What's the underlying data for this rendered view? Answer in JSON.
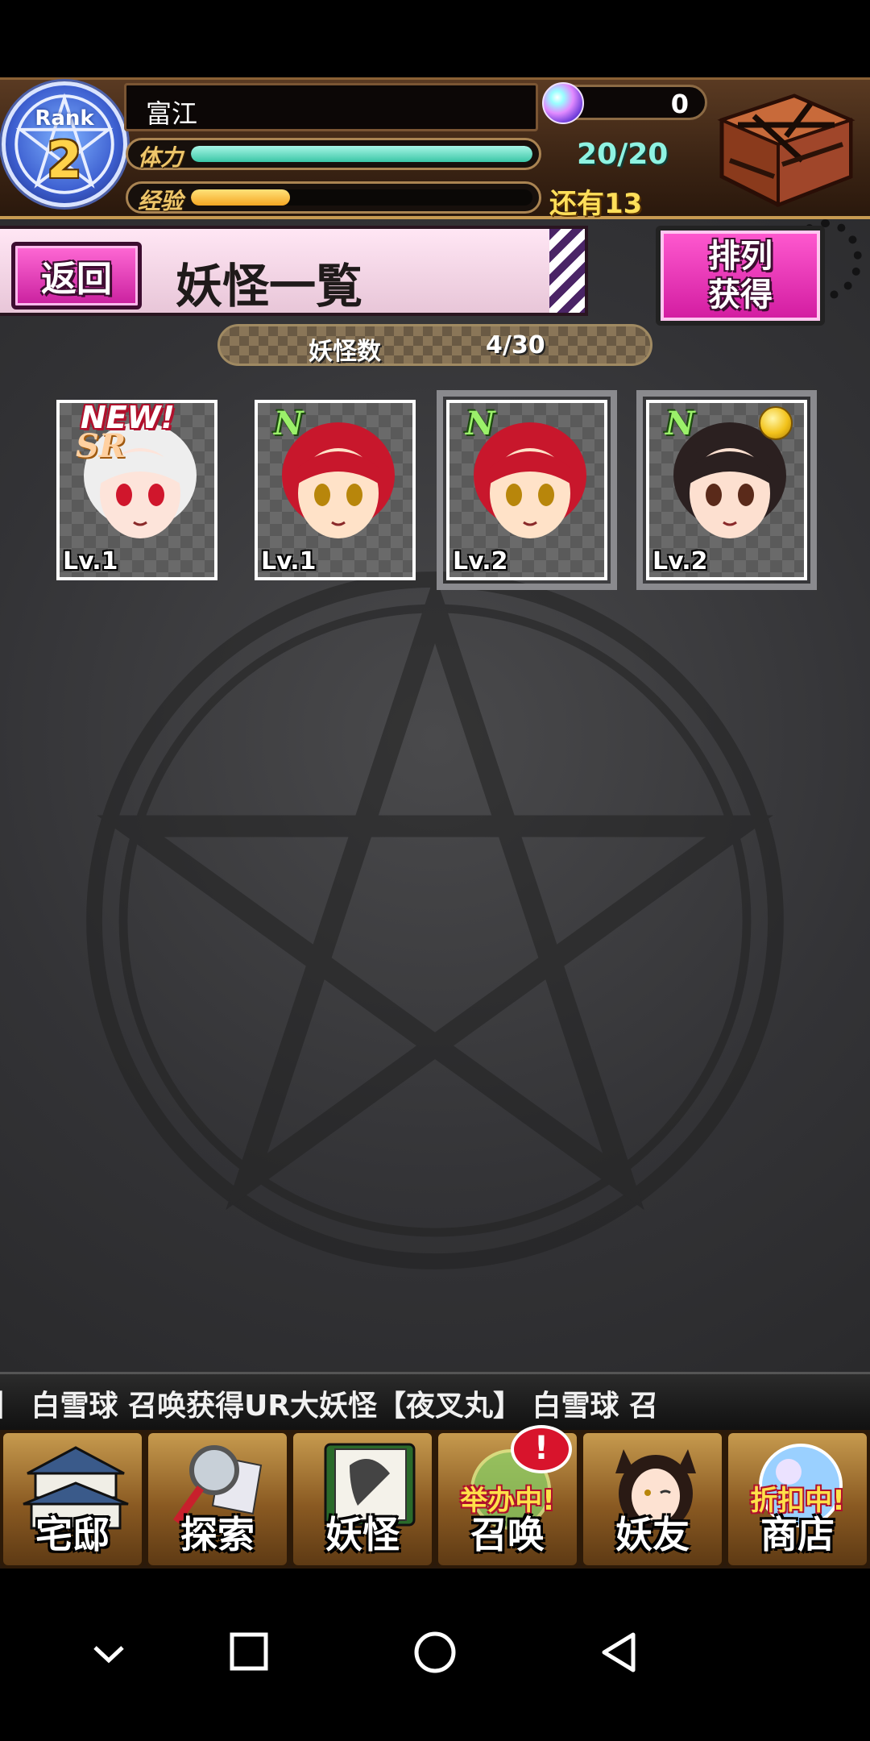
{
  "player": {
    "rank_label": "Rank",
    "rank_value": "2",
    "name": "富江",
    "stamina_label": "体力",
    "stamina_text": "20/20",
    "stamina_fraction": 1.0,
    "exp_label": "经验",
    "exp_fraction": 0.29,
    "exp_remaining": "还有13",
    "orb_count": "0"
  },
  "page": {
    "back_label": "返回",
    "title": "妖怪一覧",
    "sort_line1": "排列",
    "sort_line2": "获得",
    "count_label": "妖怪数",
    "count_value": "4/30"
  },
  "cards": [
    {
      "rarity": "SR",
      "level": "Lv.1",
      "badge": "NEW!",
      "frame": "#2b5fd8",
      "hair": "#eeeeee",
      "skin": "#fde4da",
      "eyes": "#d0162c"
    },
    {
      "rarity": "N",
      "level": "Lv.1",
      "badge": "",
      "frame": "#2b5fd8",
      "hair": "#c8172c",
      "skin": "#ffe2c8",
      "eyes": "#b8860b"
    },
    {
      "rarity": "N",
      "level": "Lv.2",
      "badge": "",
      "frame": "#2b5fd8",
      "hair": "#c8172c",
      "skin": "#ffe2c8",
      "eyes": "#b8860b"
    },
    {
      "rarity": "N",
      "level": "Lv.2",
      "badge": "",
      "frame": "#3bb53a",
      "hair": "#2b2020",
      "skin": "#fde0d0",
      "eyes": "#5a2a1a"
    }
  ],
  "ticker": {
    "text": "也】    白雪球 召唤获得UR大妖怪【夜叉丸】    白雪球 召"
  },
  "nav": {
    "items": [
      {
        "label": "宅邸",
        "icon": "mansion-icon"
      },
      {
        "label": "探索",
        "icon": "magnifier-map-icon"
      },
      {
        "label": "妖怪",
        "icon": "scroll-icon"
      },
      {
        "label": "召唤",
        "icon": "summon-circle-icon",
        "tag": "举办中!",
        "alert": "!"
      },
      {
        "label": "妖友",
        "icon": "cat-girl-icon"
      },
      {
        "label": "商店",
        "icon": "crystal-orb-icon",
        "tag": "折扣中!"
      }
    ]
  },
  "colors": {
    "accent_pink": "#e43fb8",
    "stamina": "#3ac6a6",
    "exp": "#f5a623"
  }
}
